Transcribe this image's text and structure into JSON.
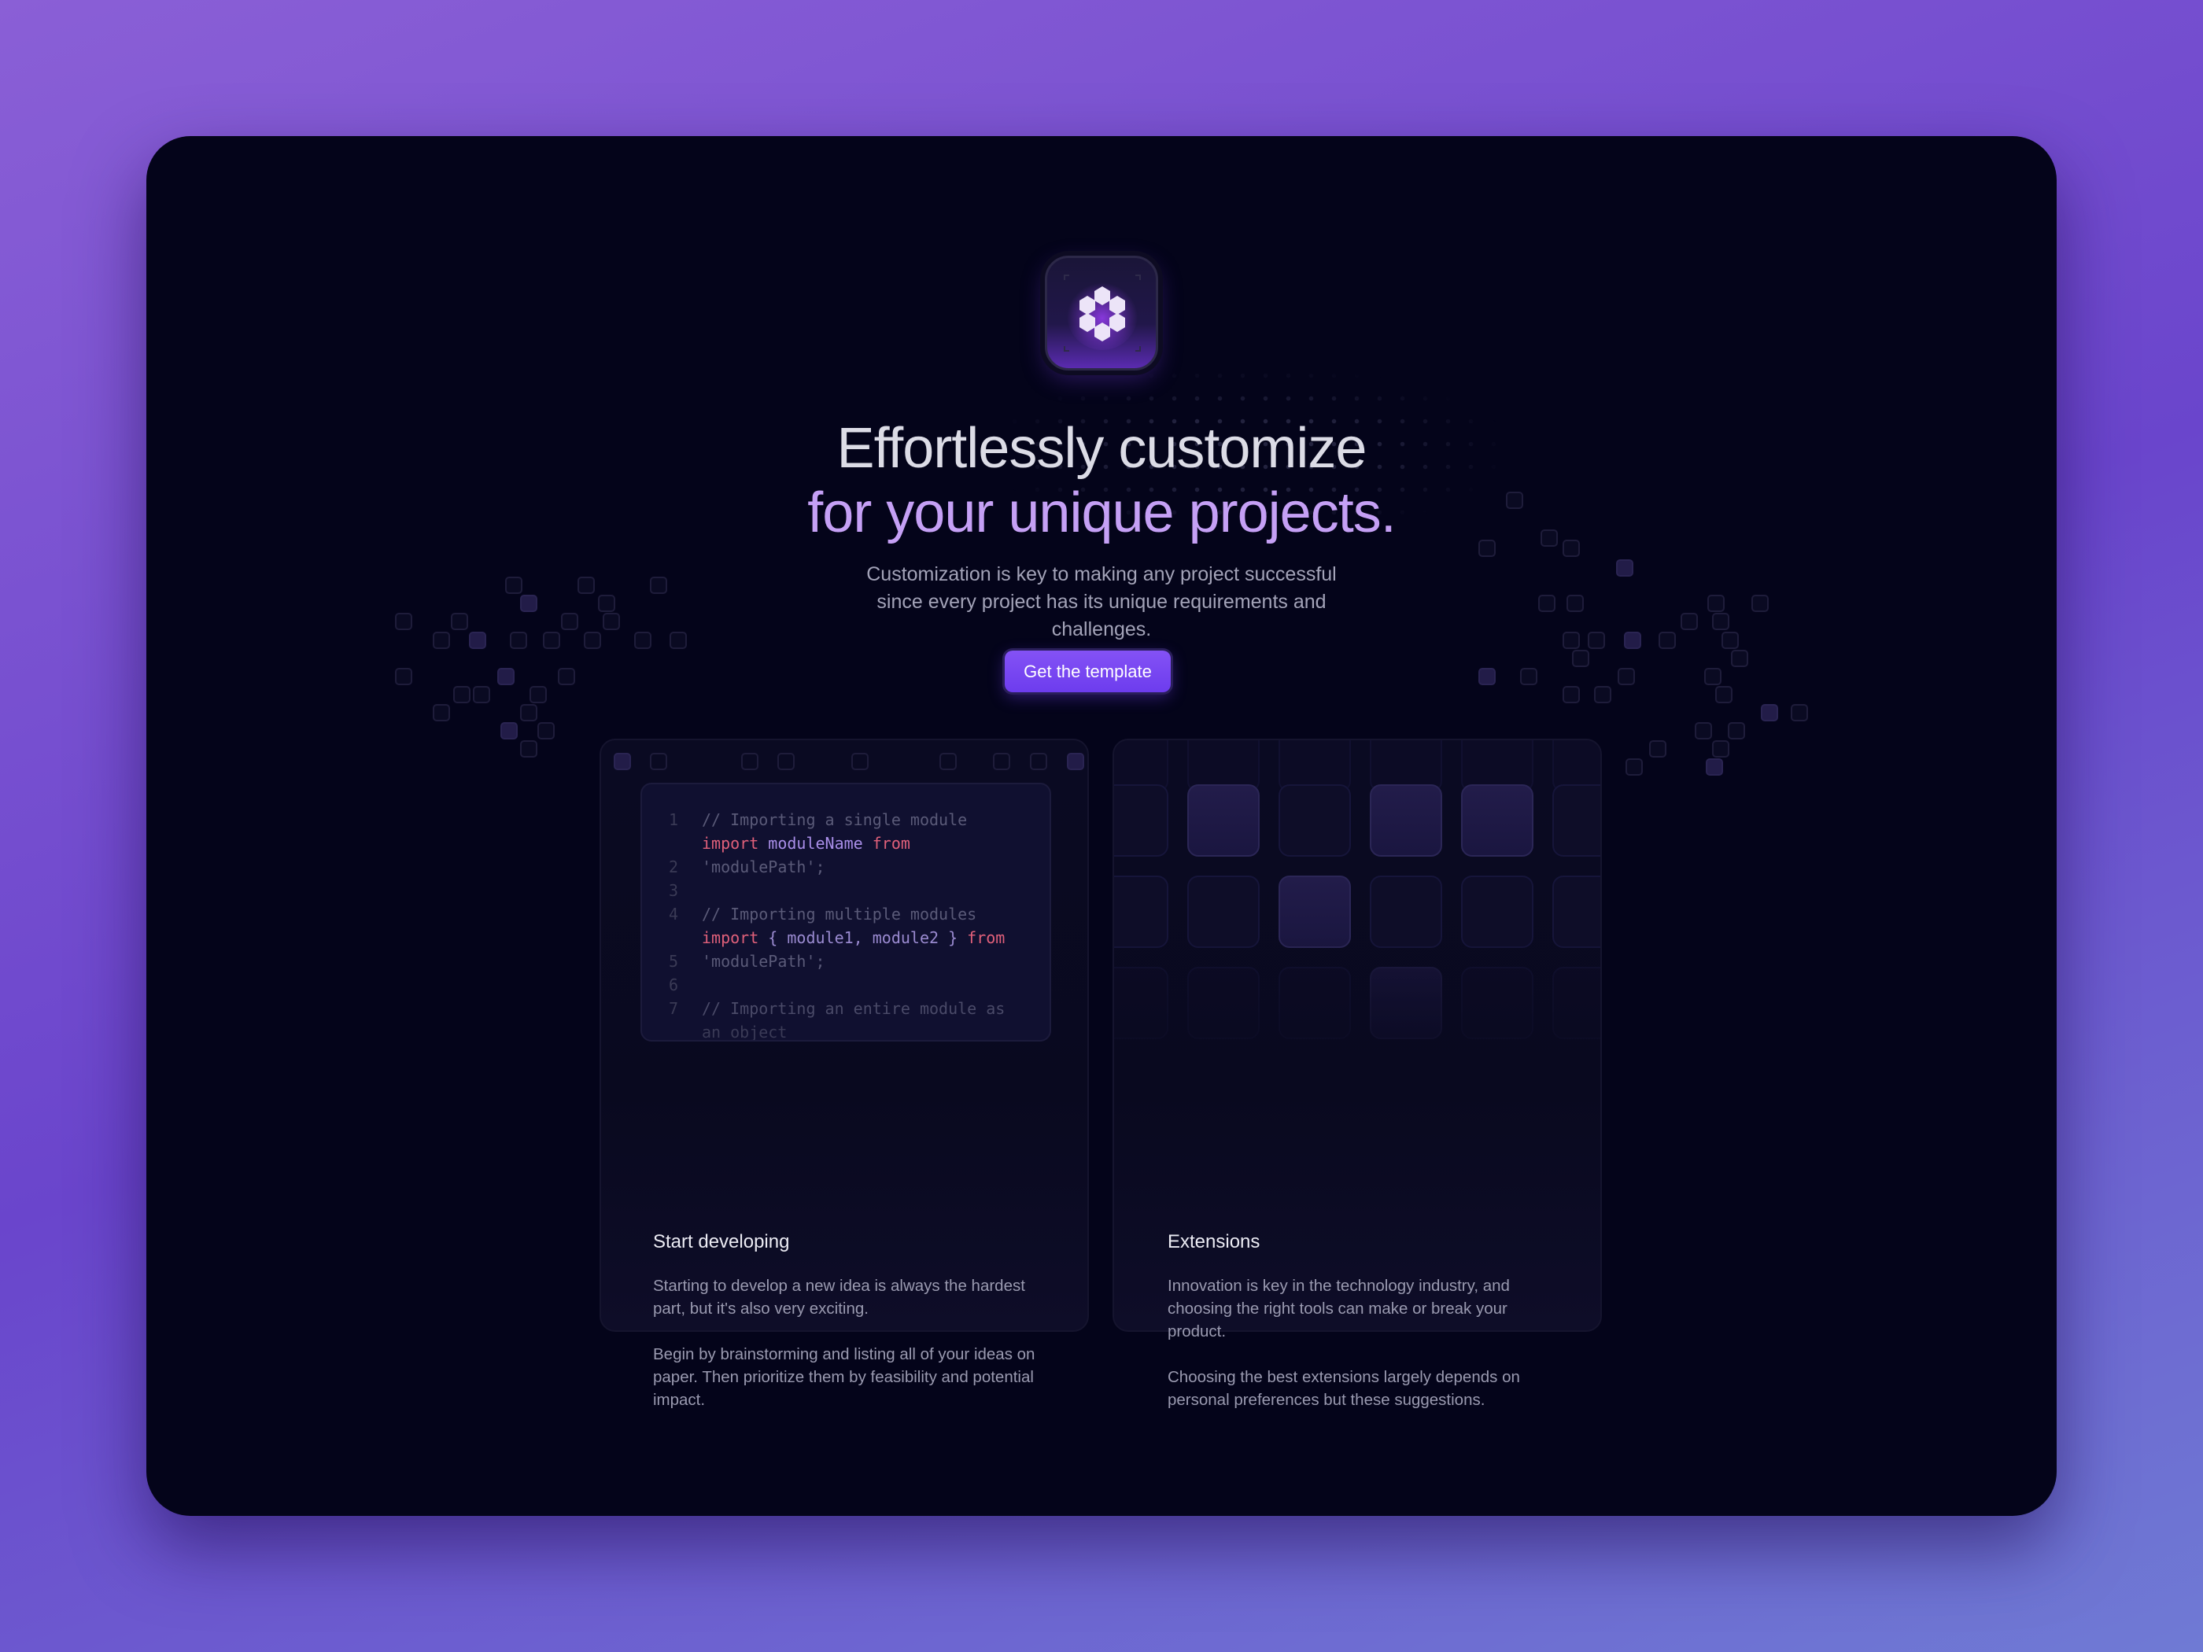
{
  "hero": {
    "headline_line1": "Effortlessly customize",
    "headline_line2": "for your unique projects.",
    "subtitle": "Customization is key to making any project successful since every project has its unique requirements and challenges.",
    "cta_label": "Get the template",
    "logo_icon": "hexagon-cluster-icon"
  },
  "colors": {
    "accent": "#7c4df2",
    "headline_accent": "#c5a0f5",
    "background": "#04041a",
    "page_bg": "#7a55d2"
  },
  "cards": [
    {
      "title": "Start developing",
      "paragraphs": [
        "Starting to develop a new idea is always the hardest part, but it's also very exciting.",
        "Begin by brainstorming and listing all of your ideas on paper. Then prioritize them by feasibility and potential impact."
      ],
      "code": {
        "line_numbers": [
          "1",
          "2",
          "3",
          "4",
          "5",
          "6",
          "7"
        ],
        "lines": [
          "// Importing a single module",
          "import moduleName from",
          "'modulePath';",
          "",
          "// Importing multiple modules",
          "import { module1, module2 } from",
          "'modulePath';",
          "",
          "// Importing an entire module as",
          "an object"
        ]
      }
    },
    {
      "title": "Extensions",
      "paragraphs": [
        "Innovation is key in the technology industry, and choosing the right tools can make or break your product.",
        "Choosing the best extensions largely depends on personal preferences but these suggestions."
      ]
    }
  ]
}
